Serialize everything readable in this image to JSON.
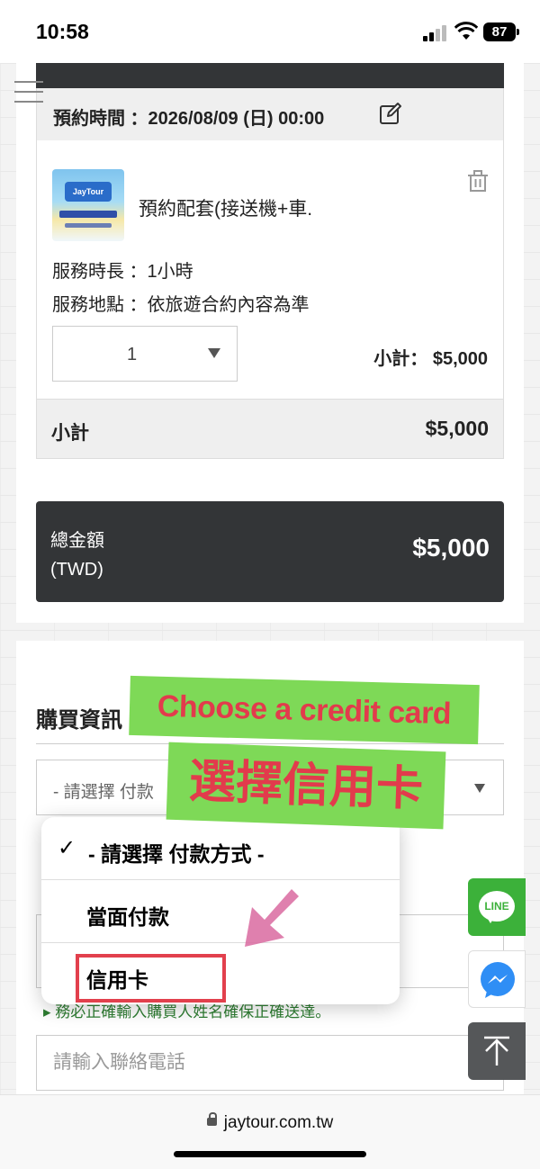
{
  "status_bar": {
    "time": "10:58",
    "battery": "87"
  },
  "booking": {
    "label": "預約時間 ：2026/08/09 (日) 00:00",
    "product_name": "預約配套(接送機+車.",
    "thumb_badge": "JayTour",
    "duration": "服務時長 ：1小時",
    "location": "服務地點 ：依旅遊合約內容為準",
    "quantity": "1",
    "line_subtotal": "小計： $5,000"
  },
  "subtotal": {
    "label": "小計",
    "value": "$5,000"
  },
  "total": {
    "label": "總金額\n(TWD)",
    "value": "$5,000"
  },
  "purchase": {
    "title": "購買資訊",
    "payment_select_text": "- 請選擇 付款",
    "name_label_stub": "",
    "name_hint": "▸ 務必正確輸入購買人姓名確保正確送達。",
    "phone_placeholder": "請輸入聯絡電話"
  },
  "dropdown": {
    "options": [
      {
        "label": "- 請選擇 付款方式 -",
        "checked": "✓"
      },
      {
        "label": "當面付款"
      },
      {
        "label": "信用卡"
      }
    ]
  },
  "stickers": {
    "english": "Choose a credit card",
    "chinese": "選擇信用卡"
  },
  "floating": {
    "line_label": "LINE"
  },
  "browser": {
    "url": "jaytour.com.tw"
  },
  "colors": {
    "dark_panel": "#333537",
    "sticker_green": "#7ed957",
    "sticker_red": "#e23b4c",
    "line_green": "#3cb13a",
    "highlight_red": "#e2404d",
    "hint_green": "#2e7d32"
  }
}
